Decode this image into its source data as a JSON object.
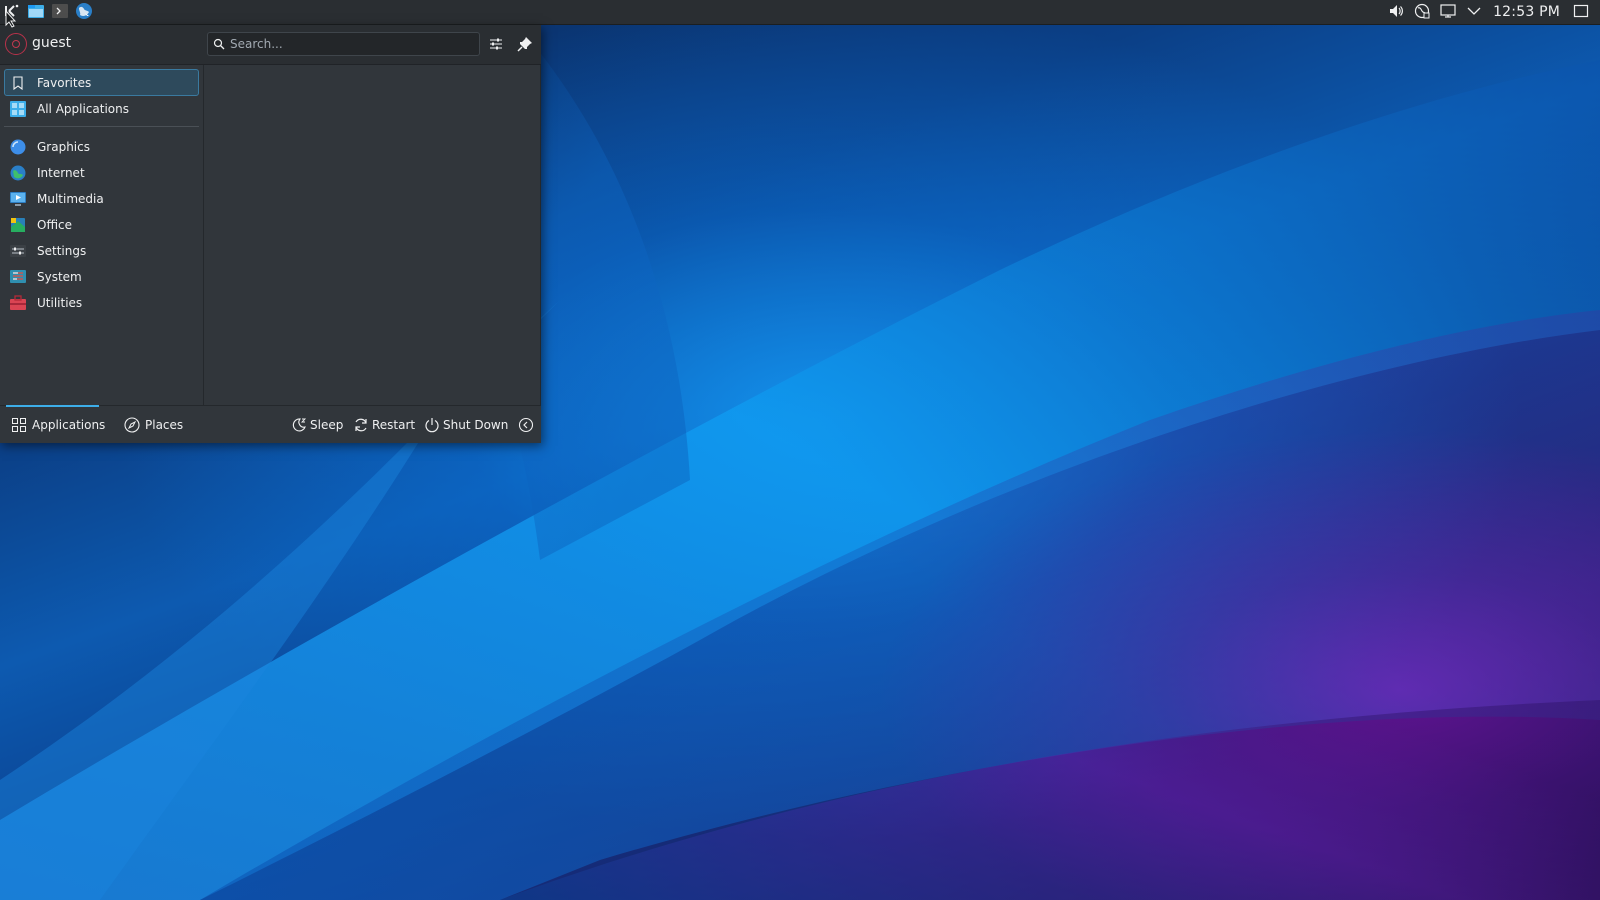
{
  "panel": {
    "left_icons": [
      "launcher-icon",
      "file-manager-icon",
      "terminal-icon",
      "web-browser-icon"
    ],
    "tray_icons": [
      "volume-icon",
      "network-icon",
      "display-icon",
      "expand-arrow-icon"
    ],
    "clock": "12:53 PM",
    "show_desktop_icon": "show-desktop-icon"
  },
  "menu": {
    "user_name": "guest",
    "search_placeholder": "Search...",
    "header_buttons": [
      "configure-icon",
      "pin-icon"
    ],
    "categories_top": [
      {
        "label": "Favorites",
        "icon": "bookmark-icon",
        "selected": true
      },
      {
        "label": "All Applications",
        "icon": "all-apps-icon",
        "selected": false
      }
    ],
    "categories": [
      {
        "label": "Graphics",
        "icon": "graphics-icon"
      },
      {
        "label": "Internet",
        "icon": "internet-icon"
      },
      {
        "label": "Multimedia",
        "icon": "multimedia-icon"
      },
      {
        "label": "Office",
        "icon": "office-icon"
      },
      {
        "label": "Settings",
        "icon": "settings-icon"
      },
      {
        "label": "System",
        "icon": "system-icon"
      },
      {
        "label": "Utilities",
        "icon": "utilities-icon"
      }
    ],
    "tabs": [
      {
        "label": "Applications",
        "icon": "applications-grid-icon",
        "active": true
      },
      {
        "label": "Places",
        "icon": "compass-icon",
        "active": false
      }
    ],
    "power": [
      {
        "label": "Sleep",
        "icon": "sleep-icon"
      },
      {
        "label": "Restart",
        "icon": "restart-icon"
      },
      {
        "label": "Shut Down",
        "icon": "shutdown-icon"
      }
    ],
    "leave_icon": "leave-arrow-icon"
  },
  "colors": {
    "panel_bg": "#2a2e32",
    "menu_bg": "#31363b",
    "accent": "#3daee9",
    "selection_bg": "#2e4a5c"
  }
}
